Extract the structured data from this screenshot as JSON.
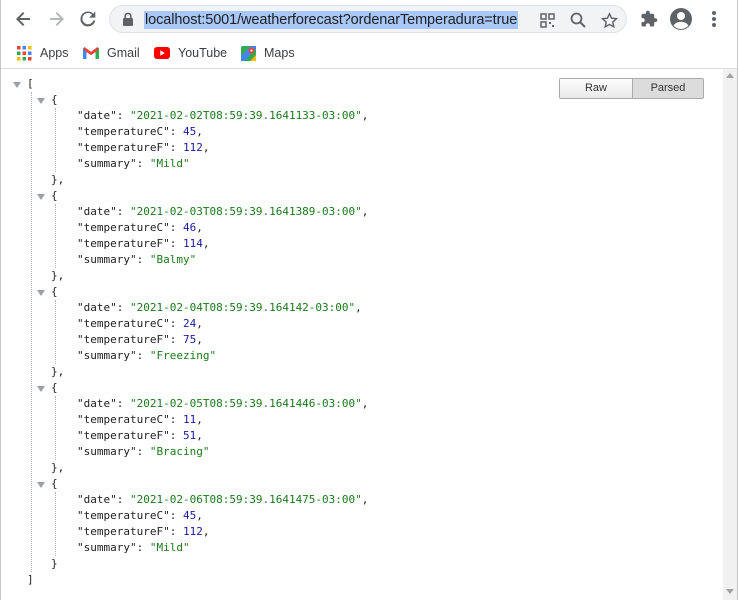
{
  "toolbar": {
    "url": "localhost:5001/weatherforecast?ordenarTemperadura=true"
  },
  "bookmarks": [
    {
      "label": "Apps",
      "icon": "apps-grid-icon"
    },
    {
      "label": "Gmail",
      "icon": "gmail-icon"
    },
    {
      "label": "YouTube",
      "icon": "youtube-icon"
    },
    {
      "label": "Maps",
      "icon": "maps-icon"
    }
  ],
  "viewer": {
    "raw_label": "Raw",
    "parsed_label": "Parsed"
  },
  "json_punct": {
    "open_array": "[",
    "close_array": "]",
    "open_obj": "{",
    "close_obj": "},",
    "close_obj_last": "}"
  },
  "keys": {
    "date": "\"date\"",
    "temperatureC": "\"temperatureC\"",
    "temperatureF": "\"temperatureF\"",
    "summary": "\"summary\""
  },
  "forecasts": [
    {
      "date": "\"2021-02-02T08:59:39.1641133-03:00\"",
      "temperatureC": "45",
      "temperatureF": "112",
      "summary": "\"Mild\""
    },
    {
      "date": "\"2021-02-03T08:59:39.1641389-03:00\"",
      "temperatureC": "46",
      "temperatureF": "114",
      "summary": "\"Balmy\""
    },
    {
      "date": "\"2021-02-04T08:59:39.164142-03:00\"",
      "temperatureC": "24",
      "temperatureF": "75",
      "summary": "\"Freezing\""
    },
    {
      "date": "\"2021-02-05T08:59:39.1641446-03:00\"",
      "temperatureC": "11",
      "temperatureF": "51",
      "summary": "\"Bracing\""
    },
    {
      "date": "\"2021-02-06T08:59:39.1641475-03:00\"",
      "temperatureC": "45",
      "temperatureF": "112",
      "summary": "\"Mild\""
    }
  ]
}
